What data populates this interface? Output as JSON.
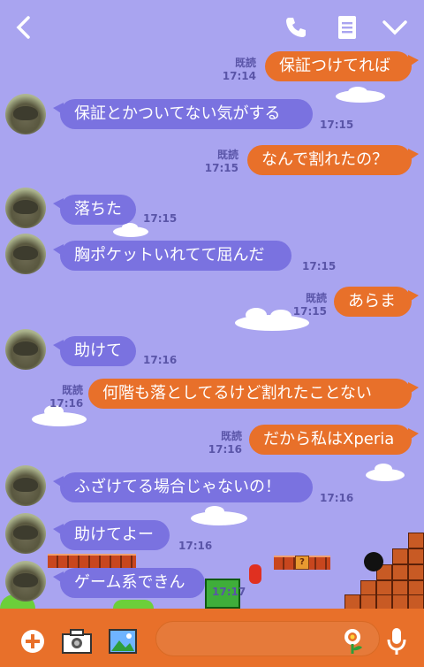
{
  "header": {
    "back_icon": "chevron-left-icon",
    "call_icon": "phone-icon",
    "notes_icon": "notes-icon",
    "menu_icon": "chevron-down-icon"
  },
  "messages": [
    {
      "side": "out",
      "text": "保証つけてれば",
      "read": "既読",
      "time": "17:14"
    },
    {
      "side": "in",
      "text": "保証とかついてない気がする",
      "time": "17:15"
    },
    {
      "side": "out",
      "text": "なんで割れたの？",
      "read": "既読",
      "time": "17:15"
    },
    {
      "side": "in",
      "text": "落ちた",
      "time": "17:15"
    },
    {
      "side": "in",
      "text": "胸ポケットいれてて屈んだ",
      "time": "17:15"
    },
    {
      "side": "out",
      "text": "あらま",
      "read": "既読",
      "time": "17:15"
    },
    {
      "side": "in",
      "text": "助けて",
      "time": "17:16"
    },
    {
      "side": "out",
      "text": "何階も落としてるけど割れたことない",
      "read": "既読",
      "time": "17:16"
    },
    {
      "side": "out",
      "text": "だから私はXperia",
      "read": "既読",
      "time": "17:16"
    },
    {
      "side": "in",
      "text": "ふざけてる場合じゃないの！",
      "time": "17:16"
    },
    {
      "side": "in",
      "text": "助けてよー",
      "time": "17:16"
    },
    {
      "side": "in",
      "text": "ゲーム系できん",
      "time": "17:17"
    }
  ],
  "scenery": {
    "qblock_mark": "?"
  },
  "input_bar": {
    "plus_icon": "plus-icon",
    "camera_icon": "camera-icon",
    "image_icon": "image-icon",
    "message_placeholder": "",
    "sticker_icon": "sticker-flower-icon",
    "mic_icon": "microphone-icon"
  },
  "colors": {
    "background": "#a9a4f0",
    "incoming": "#7a72e0",
    "outgoing": "#e8702a",
    "bar": "#e8702a"
  }
}
